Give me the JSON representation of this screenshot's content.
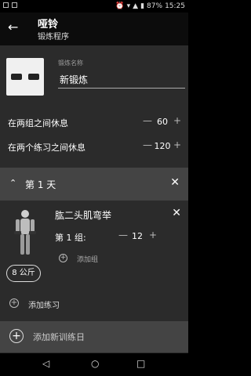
{
  "statusbar": {
    "battery": "87%",
    "time": "15:25"
  },
  "appbar": {
    "title": "哑铃",
    "subtitle": "锻炼程序"
  },
  "routine": {
    "name_label": "锻炼名称",
    "name_value": "新锻炼"
  },
  "rest": {
    "between_sets_label": "在两组之间休息",
    "between_sets_value": "60",
    "between_exercises_label": "在两个练习之间休息",
    "between_exercises_value": "120"
  },
  "day": {
    "label": "第 1 天"
  },
  "exercise": {
    "name": "肱二头肌弯举",
    "set_label": "第 1 组:",
    "reps": "12",
    "add_set_label": "添加组",
    "weight": "8 公斤"
  },
  "add_exercise_label": "添加练习",
  "add_day_label": "添加新训练日"
}
